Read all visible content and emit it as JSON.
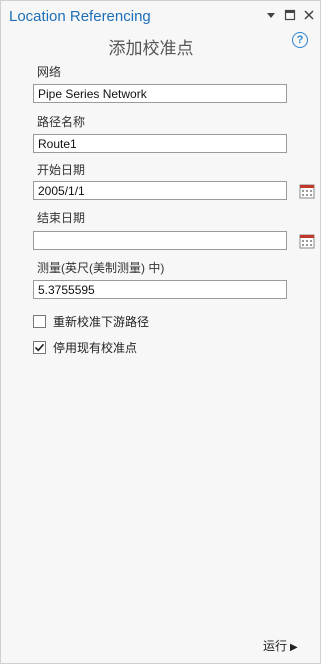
{
  "pane": {
    "title": "Location Referencing",
    "panel_title": "添加校准点",
    "help_label": "?"
  },
  "fields": {
    "network": {
      "label": "网络",
      "value": "Pipe Series Network"
    },
    "route_name": {
      "label": "路径名称",
      "value": "Route1"
    },
    "start_date": {
      "label": "开始日期",
      "value": "2005/1/1"
    },
    "end_date": {
      "label": "结束日期",
      "value": ""
    },
    "measure": {
      "label": "测量(英尺(美制测量) 中)",
      "value": "5.3755595"
    }
  },
  "options": {
    "recalibrate_downstream": {
      "label": "重新校准下游路径",
      "checked": false
    },
    "retire_existing": {
      "label": "停用现有校准点",
      "checked": true
    }
  },
  "footer": {
    "run_label": "运行",
    "run_arrow": "▶"
  },
  "icons": {
    "pin": "pin-icon",
    "maximize": "maximize-icon",
    "close": "close-icon",
    "help": "help-icon",
    "calendar": "calendar-icon",
    "check": "checkmark-icon"
  },
  "colors": {
    "title": "#1d6fb8",
    "help": "#2a84d2",
    "calendar": "#c0392b"
  }
}
